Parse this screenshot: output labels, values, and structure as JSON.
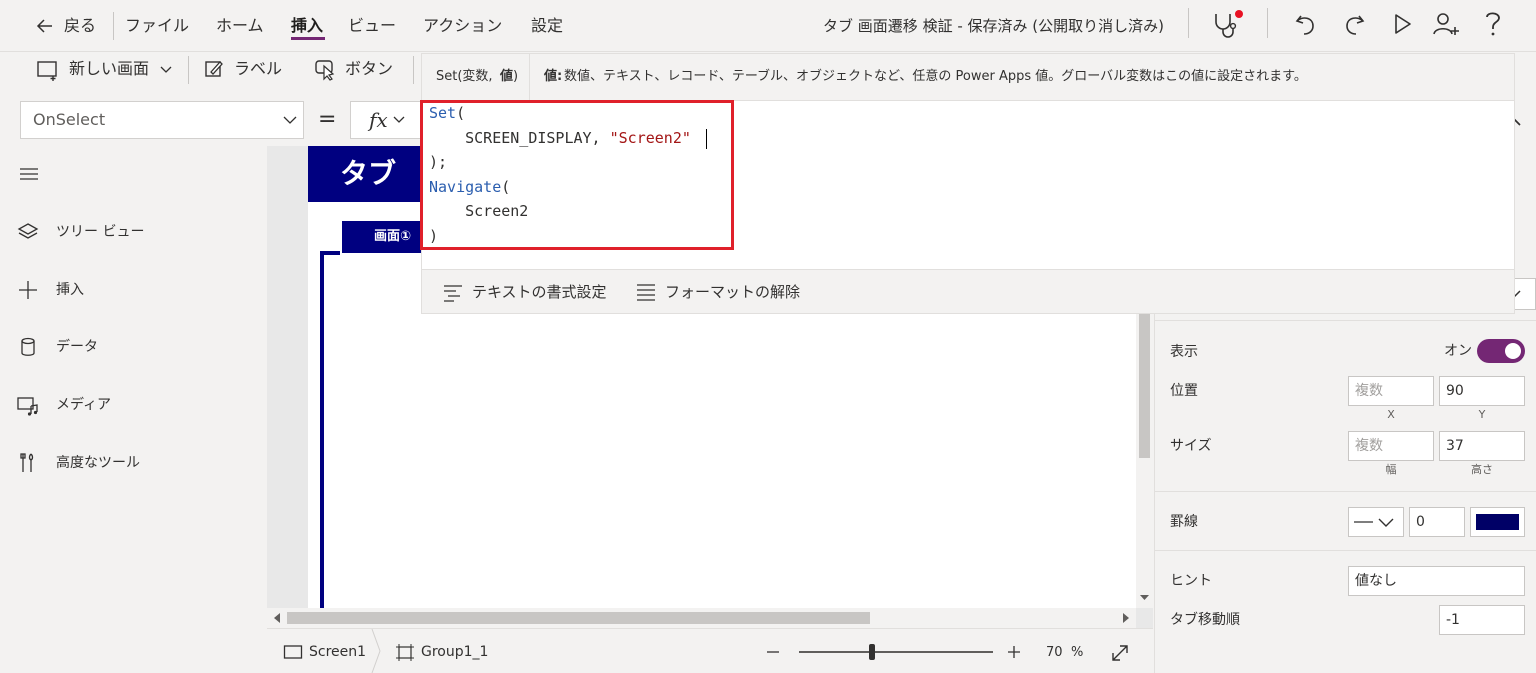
{
  "menu": {
    "back": "戻る",
    "items": [
      "ファイル",
      "ホーム",
      "挿入",
      "ビュー",
      "アクション",
      "設定"
    ],
    "active_index": 2
  },
  "doc_title": "タブ 画面遷移 検証 - 保存済み (公開取り消し済み)",
  "toolbar": {
    "new_screen": "新しい画面",
    "label": "ラベル",
    "button": "ボタン"
  },
  "property": {
    "selected": "OnSelect"
  },
  "formula_bar": {
    "equals": "=",
    "fx": "fx",
    "hint_signature": "Set(変数, ",
    "hint_signature_bold": "値",
    "hint_param_name": "値:",
    "hint_description": " 数値、テキスト、レコード、テーブル、オブジェクトなど、任意の Power Apps 値。グローバル変数はこの値に設定されます。",
    "code": {
      "line1_kw": "Set",
      "line1_rest": "(",
      "line2_plain": "    SCREEN_DISPLAY, ",
      "line2_str": "\"Screen2\"",
      "line3": ");",
      "line4_kw": "Navigate",
      "line4_rest": "(",
      "line5": "    Screen2",
      "line6": ")"
    },
    "format_text": "テキストの書式設定",
    "remove_format": "フォーマットの解除"
  },
  "left_nav": {
    "items": [
      {
        "label": "ツリー ビュー",
        "icon": "layers-icon"
      },
      {
        "label": "挿入",
        "icon": "plus-icon"
      },
      {
        "label": "データ",
        "icon": "database-icon"
      },
      {
        "label": "メディア",
        "icon": "media-icon"
      },
      {
        "label": "高度なツール",
        "icon": "tools-icon"
      }
    ]
  },
  "canvas": {
    "app_title": "タブ",
    "tab1": "画面①"
  },
  "right_pane": {
    "visible_label": "表示",
    "visible_state": "オン",
    "visible_on": true,
    "position_label": "位置",
    "position_x": "複数",
    "position_y": "90",
    "x_caption": "X",
    "y_caption": "Y",
    "size_label": "サイズ",
    "size_w": "複数",
    "size_h": "37",
    "w_caption": "幅",
    "h_caption": "高さ",
    "border_label": "罫線",
    "border_width": "0",
    "border_color": "#000066",
    "hint_label": "ヒント",
    "hint_value": "値なし",
    "tab_order_label": "タブ移動順",
    "tab_order_value": "-1"
  },
  "status": {
    "screen": "Screen1",
    "group": "Group1_1",
    "zoom": "70",
    "zoom_unit": "%"
  },
  "colors": {
    "accent": "#742774",
    "app_navy": "#000080",
    "highlight_box": "#e0202a"
  }
}
